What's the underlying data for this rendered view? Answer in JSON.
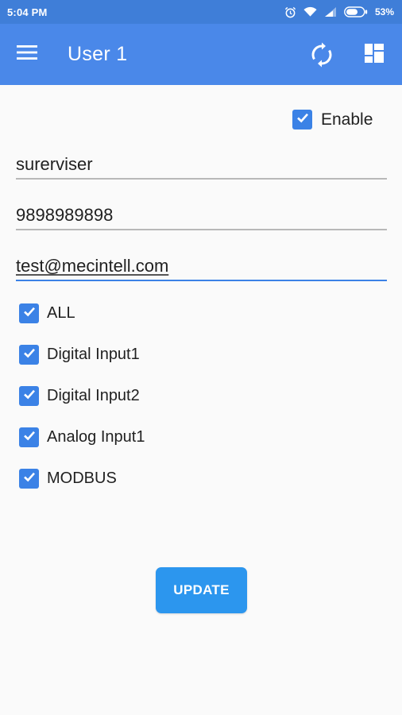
{
  "status_bar": {
    "time": "5:04 PM",
    "battery": "53%",
    "icons": [
      "alarm-icon",
      "wifi-icon",
      "signal-icon",
      "battery-icon"
    ]
  },
  "app_bar": {
    "title": "User 1",
    "icons": [
      "menu-icon",
      "sync-icon",
      "dashboard-icon"
    ]
  },
  "enable": {
    "label": "Enable",
    "checked": true
  },
  "fields": {
    "name": "surerviser",
    "phone": "9898989898",
    "email": "test@mecintell.com"
  },
  "checklist": [
    {
      "label": "ALL",
      "checked": true
    },
    {
      "label": "Digital Input1",
      "checked": true
    },
    {
      "label": "Digital Input2",
      "checked": true
    },
    {
      "label": "Analog Input1",
      "checked": true
    },
    {
      "label": "MODBUS",
      "checked": true
    }
  ],
  "update_button": {
    "label": "UPDATE"
  },
  "colors": {
    "status_bar": "#3f7ed8",
    "app_bar": "#4a88e9",
    "accent": "#3b82e6",
    "button": "#2c96ee"
  }
}
